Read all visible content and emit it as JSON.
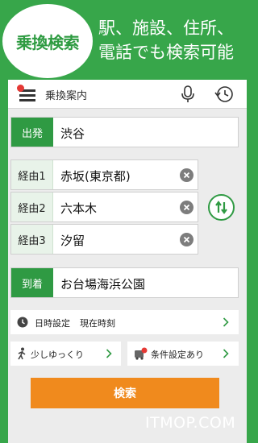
{
  "promo": {
    "badge_text": "乗換検索",
    "tagline_line1": "駅、施設、住所、",
    "tagline_line2": "電話でも検索可能"
  },
  "app": {
    "title": "乗換案内",
    "icons": {
      "menu": "hamburger-menu-icon",
      "notification": "red-dot-badge",
      "voice": "microphone-icon",
      "history": "clock-history-icon"
    }
  },
  "route": {
    "from": {
      "label": "出発",
      "value": "渋谷"
    },
    "via": [
      {
        "label": "経由1",
        "value": "赤坂(東京都)"
      },
      {
        "label": "経由2",
        "value": "六本木"
      },
      {
        "label": "経由3",
        "value": "汐留"
      }
    ],
    "to": {
      "label": "到着",
      "value": "お台場海浜公園"
    },
    "swap_icon": "swap-arrows-icon"
  },
  "options": {
    "datetime_label": "日時設定",
    "datetime_value": "現在時刻",
    "pace_label": "少しゆっくり",
    "conditions_label": "条件設定あり"
  },
  "search_button": "検索",
  "watermark": "ITMOP.COM",
  "colors": {
    "background": "#37a64a",
    "accent_green": "#2f9a43",
    "search_orange": "#f08a1d",
    "badge_red": "#e53935"
  }
}
